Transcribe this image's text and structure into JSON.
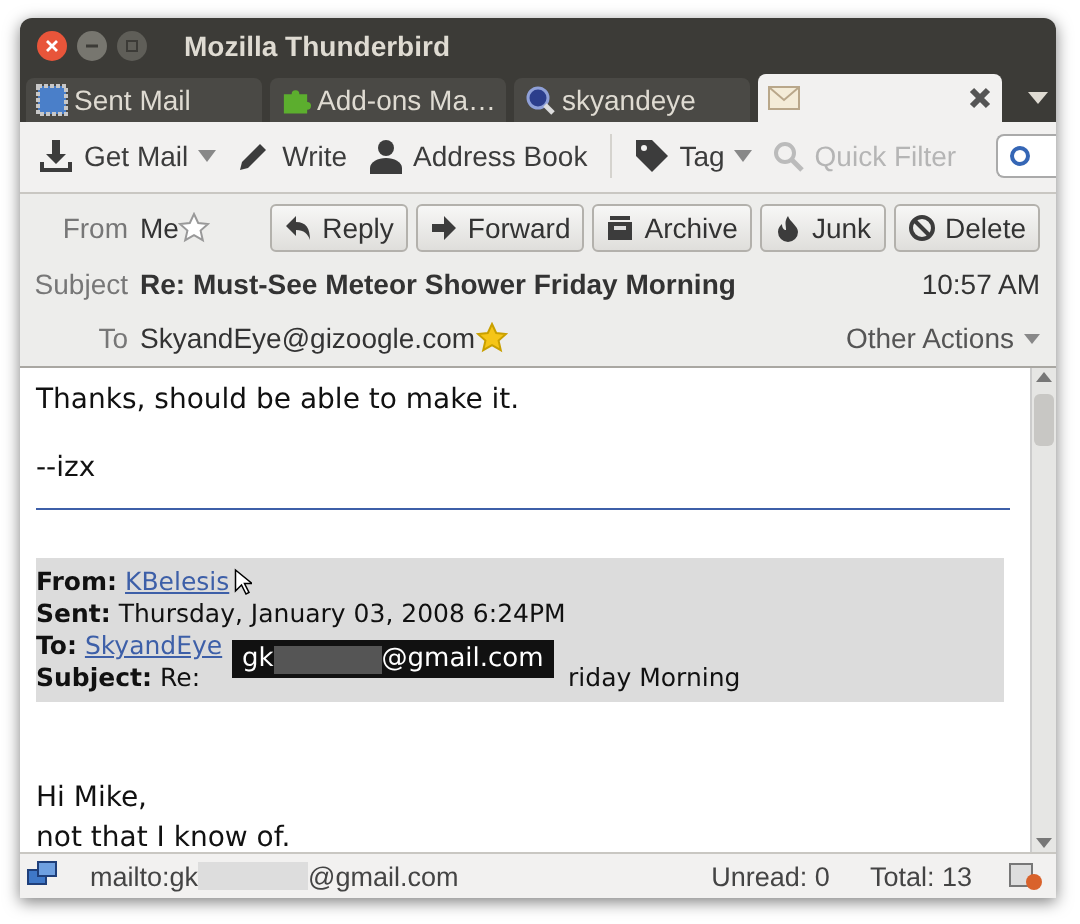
{
  "window": {
    "title": "Mozilla Thunderbird"
  },
  "tabs": [
    {
      "label": "Sent Mail",
      "kind": "folder",
      "selected": false
    },
    {
      "label": "Add-ons Ma…",
      "kind": "addons",
      "selected": false
    },
    {
      "label": "skyandeye",
      "kind": "search",
      "selected": false
    },
    {
      "kind": "message",
      "selected": true
    }
  ],
  "toolbar": [
    {
      "label": "Get Mail",
      "kind": "get-mail",
      "dropdown": true,
      "disabled": false
    },
    {
      "label": "Write",
      "kind": "write",
      "dropdown": false,
      "disabled": false
    },
    {
      "label": "Address Book",
      "kind": "address-book",
      "dropdown": false,
      "disabled": false
    },
    {
      "label": "Tag",
      "kind": "tag",
      "dropdown": true,
      "disabled": false
    },
    {
      "label": "Quick Filter",
      "kind": "quick-filter",
      "dropdown": false,
      "disabled": true
    }
  ],
  "header": {
    "from_label": "From",
    "from": "Me",
    "from_starred": false,
    "subject_label": "Subject",
    "subject": "Re: Must-See Meteor Shower Friday Morning",
    "time": "10:57 AM",
    "to_label": "To",
    "to": "SkyandEye@gizoogle.com",
    "to_starred": true,
    "other_actions": "Other Actions",
    "buttons": [
      {
        "label": "Reply",
        "kind": "reply"
      },
      {
        "label": "Forward",
        "kind": "forward"
      },
      {
        "label": "Archive",
        "kind": "archive"
      },
      {
        "label": "Junk",
        "kind": "junk"
      },
      {
        "label": "Delete",
        "kind": "delete"
      }
    ]
  },
  "message": {
    "lines": [
      "Thanks, should be able to make it.",
      "--izx"
    ],
    "quote": [
      {
        "label": "From:",
        "value": "KBelesis",
        "kind": "link"
      },
      {
        "label": "Sent:",
        "value": "Thursday, January 03, 2008 6:24PM",
        "kind": "text"
      },
      {
        "label": "To:",
        "value": "SkyandEye",
        "kind": "link"
      },
      {
        "label": "Subject:",
        "value": "Re:",
        "kind": "text",
        "after_tooltip": "riday Morning"
      }
    ],
    "reply_lines": [
      "Hi Mike,",
      "not that I know of."
    ]
  },
  "tooltip": {
    "prefix": "gk",
    "suffix": "@gmail.com"
  },
  "status_bar": {
    "link_prefix": "mailto:gk",
    "link_suffix": "@gmail.com",
    "unread": "Unread: 0",
    "total": "Total: 13"
  }
}
